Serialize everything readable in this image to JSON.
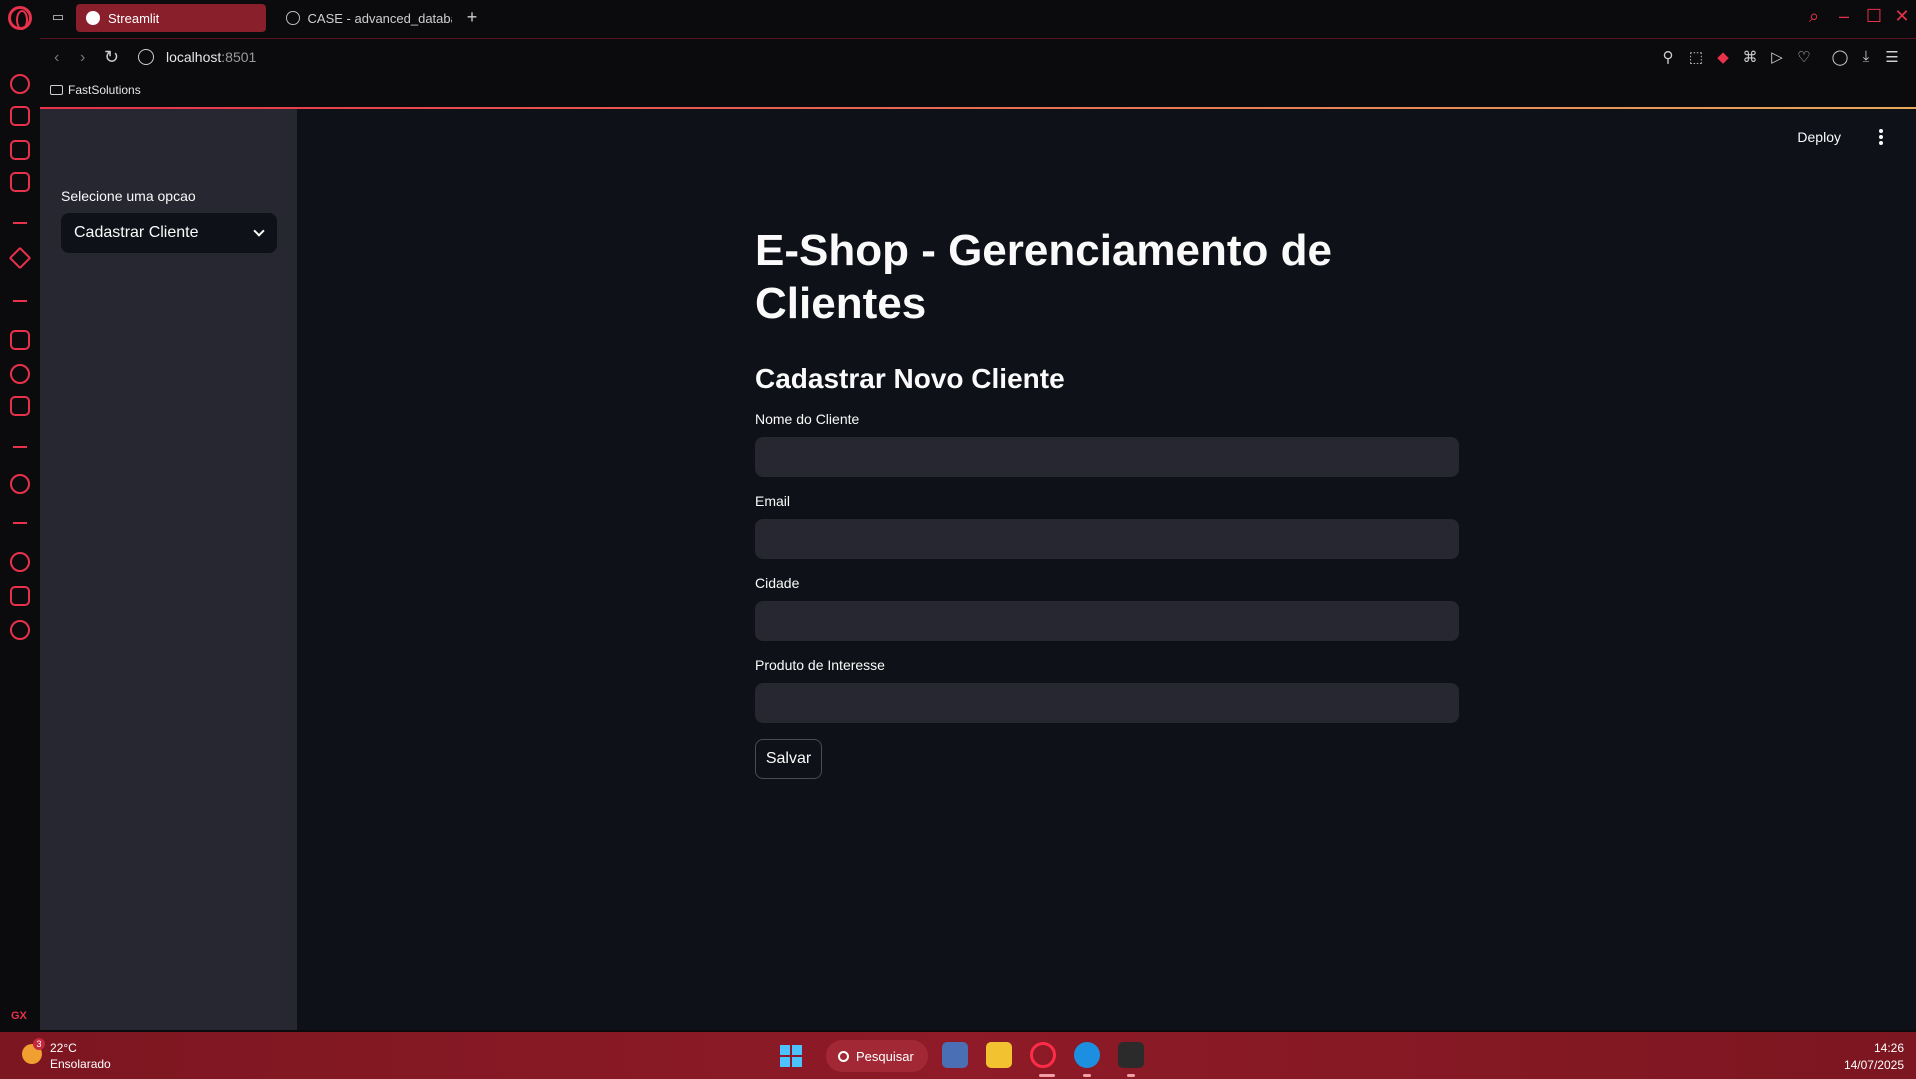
{
  "browser": {
    "tabs": [
      {
        "title": "Streamlit",
        "active": true
      },
      {
        "title": "CASE - advanced_databa",
        "active": false
      }
    ],
    "url_host": "localhost",
    "url_port": ":8501",
    "bookmarks": [
      "FastSolutions"
    ],
    "accent_color": "#e8314a"
  },
  "app": {
    "header": {
      "deploy_label": "Deploy"
    },
    "sidebar": {
      "select_label": "Selecione uma opcao",
      "select_value": "Cadastrar Cliente"
    },
    "title": "E-Shop - Gerenciamento de Clientes",
    "subtitle": "Cadastrar Novo Cliente",
    "fields": [
      {
        "label": "Nome do Cliente",
        "value": ""
      },
      {
        "label": "Email",
        "value": ""
      },
      {
        "label": "Cidade",
        "value": ""
      },
      {
        "label": "Produto de Interesse",
        "value": ""
      }
    ],
    "submit_label": "Salvar"
  },
  "taskbar": {
    "weather_badge": "3",
    "temperature": "22°C",
    "condition": "Ensolarado",
    "search_label": "Pesquisar",
    "time": "14:26",
    "date": "14/07/2025"
  }
}
